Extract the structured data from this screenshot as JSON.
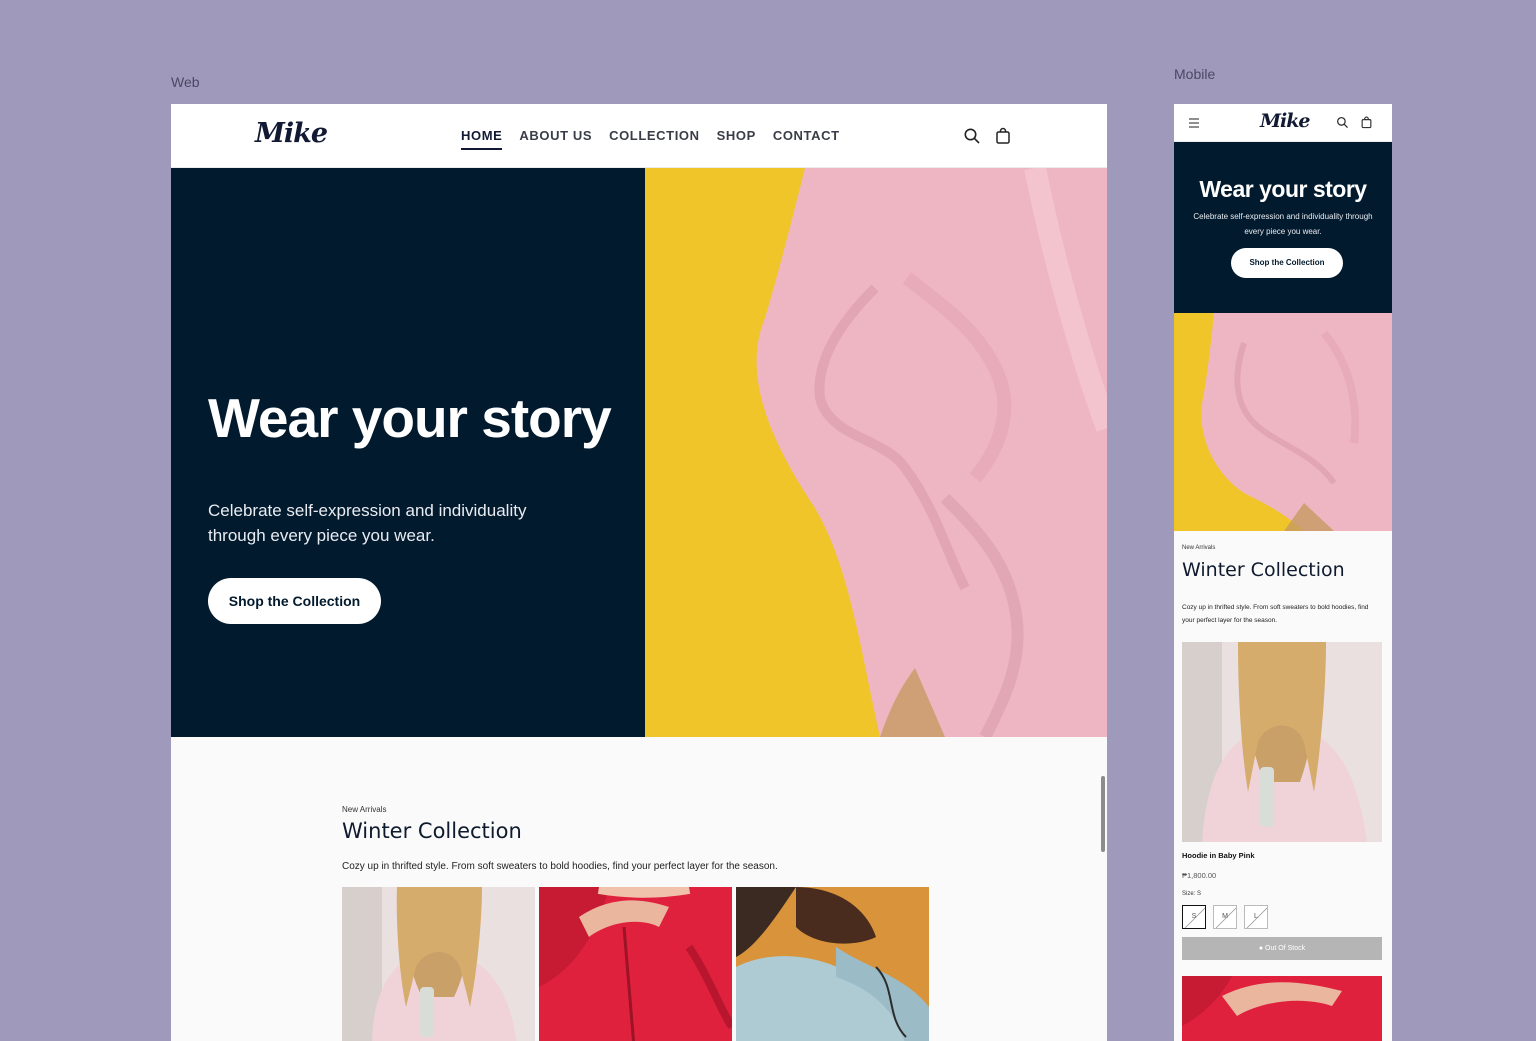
{
  "labels": {
    "web": "Web",
    "mobile": "Mobile"
  },
  "brand": {
    "logo": "Mike"
  },
  "nav": {
    "items": [
      {
        "label": "HOME",
        "active": true
      },
      {
        "label": "ABOUT US",
        "active": false
      },
      {
        "label": "COLLECTION",
        "active": false
      },
      {
        "label": "SHOP",
        "active": false
      },
      {
        "label": "CONTACT",
        "active": false
      }
    ]
  },
  "icons": {
    "search": "search-icon",
    "cart": "shopping-bag-icon",
    "menu": "hamburger-menu-icon"
  },
  "hero": {
    "title": "Wear your story",
    "subtitle": "Celebrate self-expression and individuality through every piece you wear.",
    "cta": "Shop the Collection"
  },
  "collection": {
    "kicker": "New Arrivals",
    "title": "Winter Collection",
    "description": "Cozy up in thrifted style. From soft sweaters to bold hoodies, find your perfect layer for the season."
  },
  "product": {
    "name": "Hoodie in Baby Pink",
    "price": "₱1,800.00",
    "size_label": "Size: S",
    "sizes": [
      "S",
      "M",
      "L"
    ],
    "stock_button": "Out Of Stock"
  },
  "colors": {
    "page_bg": "#9f9abb",
    "hero_bg": "#021a2d",
    "hero_accent_yellow": "#f0c52a",
    "hoodie_pink": "#eeb6c3"
  }
}
